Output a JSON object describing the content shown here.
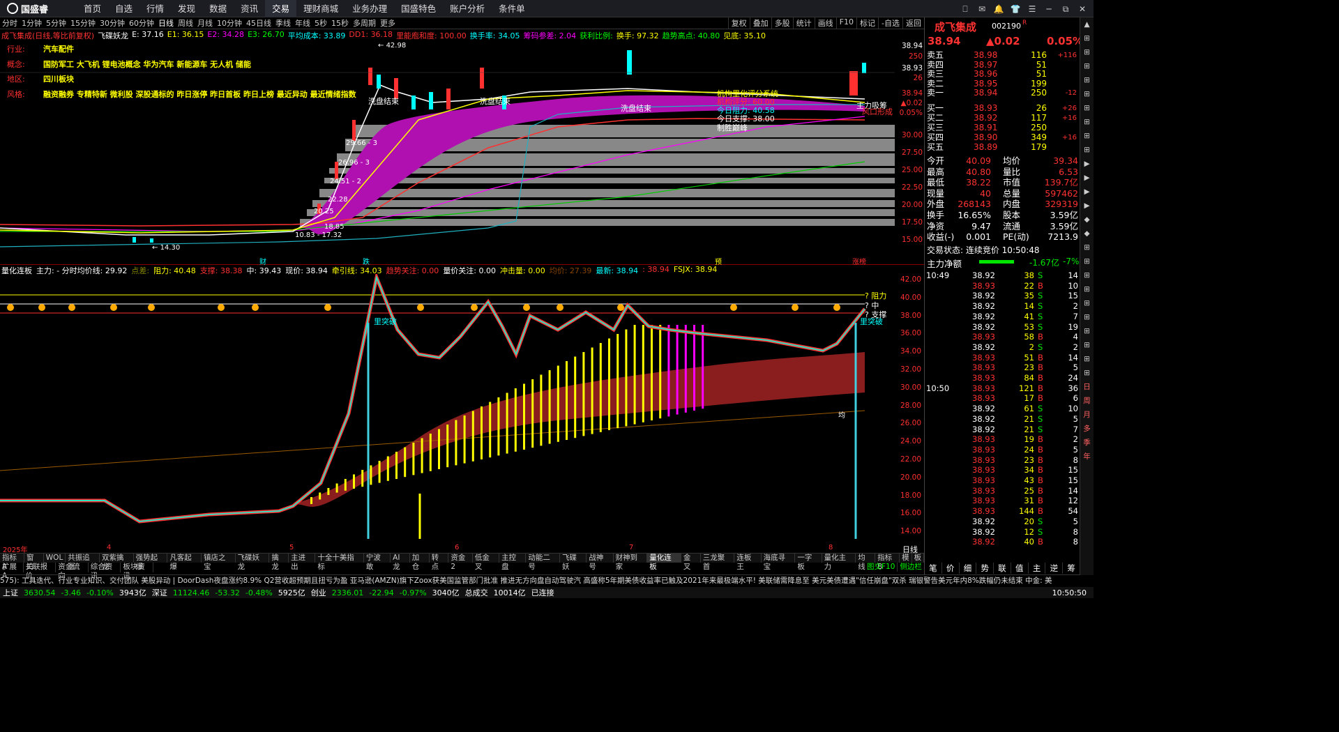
{
  "app": {
    "logo": "国盛睿"
  },
  "menu": [
    "首页",
    "自选",
    "行情",
    "发现",
    "数据",
    "资讯",
    "交易",
    "理财商城",
    "业务办理",
    "国盛特色",
    "账户分析",
    "条件单"
  ],
  "active_menu": "交易",
  "window_controls": [
    "⎕",
    "✉",
    "🔔",
    "👕",
    "☰",
    "─",
    "⧉",
    "✕"
  ],
  "periods": [
    "分时",
    "1分钟",
    "5分钟",
    "15分钟",
    "30分钟",
    "60分钟",
    "日线",
    "周线",
    "月线",
    "10分钟",
    "45日线",
    "季线",
    "年线",
    "5秒",
    "15秒",
    "多周期",
    "更多"
  ],
  "active_period": "日线",
  "tools": [
    "复权",
    "叠加",
    "多股",
    "统计",
    "画线",
    "F10",
    "标记",
    "-自选",
    "返回"
  ],
  "chart1": {
    "title": "成飞集成(日线,等比前复权)",
    "indicator": "飞碟妖龙",
    "values": [
      {
        "k": "E:",
        "v": "37.16",
        "c": "#fff"
      },
      {
        "k": "E1:",
        "v": "36.15",
        "c": "#ffff00"
      },
      {
        "k": "E2:",
        "v": "34.28",
        "c": "#ff00ff"
      },
      {
        "k": "E3:",
        "v": "26.70",
        "c": "#00ff00"
      },
      {
        "k": "平均成本:",
        "v": "33.89",
        "c": "#00ffff"
      },
      {
        "k": "DD1:",
        "v": "36.18",
        "c": "#ff3030"
      },
      {
        "k": "里能庖和度:",
        "v": "100.00",
        "c": "#ff3030"
      },
      {
        "k": "换手率:",
        "v": "34.05",
        "c": "#00ffff"
      },
      {
        "k": "筹码参差:",
        "v": "2.04",
        "c": "#ff00ff"
      },
      {
        "k": "获利比例:",
        "v": "",
        "c": "#00ff00"
      },
      {
        "k": "换手:",
        "v": "97.32",
        "c": "#ffff00"
      },
      {
        "k": "趋势高点:",
        "v": "40.80",
        "c": "#00ff00"
      },
      {
        "k": "见底:",
        "v": "35.10",
        "c": "#ffff00"
      }
    ]
  },
  "info": {
    "rows": [
      {
        "label": "行业:",
        "value": "汽车配件"
      },
      {
        "label": "概念:",
        "value": "国防军工 大飞机 锂电池概念 华为汽车 新能源车 无人机 储能"
      },
      {
        "label": "地区:",
        "value": "四川板块"
      },
      {
        "label": "风格:",
        "value": "融资融券 专精特新 微利股 深股通标的 昨日涨停 昨日首板 昨日上榜 最近异动 最近情绪指数"
      }
    ]
  },
  "chart1_annotations": {
    "high": "42.98",
    "low": "14.30",
    "range": "10.83 - 17.32",
    "wash1": "洗盘结束",
    "wash2": "洗盘结束",
    "wash3": "洗盘结束",
    "inst": "机构里化评分系统",
    "score": "机构评分: 60.00",
    "res": "今日阻力: 40.58",
    "sup": "今日支撑: 38.00",
    "win": "制胜巅峰",
    "main": "主力吸筹",
    "risk": "风口形成",
    "levels": [
      "29.66 - 3",
      "26.96 - 3",
      "24.51 - 2",
      "22.28",
      "20.25",
      "18.85"
    ]
  },
  "yaxis1": {
    "labels": [
      "38.94",
      "250",
      "38.93",
      "26",
      "38.94",
      "▲0.02",
      "0.05%",
      "30.00",
      "27.50",
      "25.00",
      "22.50",
      "20.00",
      "17.50",
      "15.00"
    ]
  },
  "chart1_datebar": {
    "items": [
      "财",
      "跌",
      "预",
      "涨榜"
    ]
  },
  "chart2": {
    "title": "量化连板",
    "values": [
      {
        "k": "主力: - 分时均价线:",
        "v": "29.92",
        "c": "#fff"
      },
      {
        "k": "点差:",
        "v": "",
        "c": "#888800"
      },
      {
        "k": "阻力:",
        "v": "40.48",
        "c": "#ffff00"
      },
      {
        "k": "支撑:",
        "v": "38.38",
        "c": "#ff3030"
      },
      {
        "k": "中:",
        "v": "39.43",
        "c": "#fff"
      },
      {
        "k": "现价:",
        "v": "38.94",
        "c": "#fff"
      },
      {
        "k": "牵引线:",
        "v": "34.03",
        "c": "#ffff00"
      },
      {
        "k": "趋势关注:",
        "v": "0.00",
        "c": "#ff3030"
      },
      {
        "k": "量价关注:",
        "v": "0.00",
        "c": "#fff"
      },
      {
        "k": "冲击量:",
        "v": "0.00",
        "c": "#ffff00"
      },
      {
        "k": "均价:",
        "v": "27.39",
        "c": "#884400"
      },
      {
        "k": "最新:",
        "v": "38.94",
        "c": "#00ffff"
      },
      {
        "k": ":",
        "v": "38.94",
        "c": "#ff3030"
      },
      {
        "k": "FSJX:",
        "v": "38.94",
        "c": "#ffff00"
      }
    ],
    "labels": {
      "res": "阻力",
      "mid": "中",
      "sup": "支撑",
      "break1": "里突破",
      "break2": "里突破",
      "avg": "均"
    }
  },
  "yaxis2": {
    "labels": [
      "42.00",
      "40.00",
      "38.00",
      "36.00",
      "34.00",
      "32.00",
      "30.00",
      "28.00",
      "26.00",
      "24.00",
      "22.00",
      "20.00",
      "18.00",
      "16.00",
      "14.00"
    ]
  },
  "bottom_dates": {
    "items": [
      "2025年",
      "4",
      "5",
      "6",
      "7",
      "8"
    ],
    "period": "日线"
  },
  "tabs1": [
    "指标A",
    "窗口",
    "WOL",
    "共振追涨",
    "双紫擒龙",
    "强势起爆",
    "凡客起爆",
    "镇店之宝",
    "飞碟妖龙",
    "擒龙",
    "主进出",
    "十全十美指标",
    "宁波敢",
    "AI龙",
    "加仓",
    "转点",
    "资金2",
    "低金叉",
    "主控盘",
    "动能二号",
    "飞碟妖",
    "战神号",
    "财神到家",
    "量化连板",
    "金叉",
    "三龙聚首",
    "连板王",
    "海底寻宝",
    "一字板",
    "量化主力",
    "均线",
    "指标B",
    "模",
    "板"
  ],
  "active_tab": "量化连板",
  "tabs2": [
    "扩展A",
    "关联报价",
    "资金流向",
    "综合资讯",
    "板块资讯"
  ],
  "tabs3": [
    "图交F10",
    "侧边栏"
  ],
  "ticker": "575): 工具迭代、行业专业知识、交付团队      美股异动 | DoorDash夜盘涨约8.9% Q2营收超预期且扭亏为盈      亚马逊(AMZN)旗下Zoox获美国监管部门批准  推进无方向盘自动驾驶汽      高盛称5年期美债收益率已触及2021年来最极端水平! 美联储需降息至      美元美债遭遇\"信任崩盘\"双杀  瑞银警告美元年内8%跌幅仍未结束      中金: 美",
  "status": {
    "items": [
      {
        "name": "上证",
        "v1": "3630.54",
        "v2": "-3.46",
        "v3": "-0.10%",
        "v4": "3943亿"
      },
      {
        "name": "深证",
        "v1": "11124.46",
        "v2": "-53.32",
        "v3": "-0.48%",
        "v4": "5925亿"
      },
      {
        "name": "创业",
        "v1": "2336.01",
        "v2": "-22.94",
        "v3": "-0.97%",
        "v4": "3040亿"
      }
    ],
    "total_label": "总成交",
    "total": "10014亿",
    "connected": "已连接",
    "time": "10:50:50"
  },
  "quote": {
    "name": "成飞集成",
    "code": "002190",
    "flag": "R",
    "price": "38.94",
    "change": "▲0.02",
    "pct": "0.05%",
    "asks": [
      {
        "l": "卖五",
        "p": "38.98",
        "v": "116",
        "d": "+116"
      },
      {
        "l": "卖四",
        "p": "38.97",
        "v": "51",
        "d": ""
      },
      {
        "l": "卖三",
        "p": "38.96",
        "v": "51",
        "d": ""
      },
      {
        "l": "卖二",
        "p": "38.95",
        "v": "199",
        "d": ""
      },
      {
        "l": "卖一",
        "p": "38.94",
        "v": "250",
        "d": "-12"
      }
    ],
    "bids": [
      {
        "l": "买一",
        "p": "38.93",
        "v": "26",
        "d": "+26"
      },
      {
        "l": "买二",
        "p": "38.92",
        "v": "117",
        "d": "+16"
      },
      {
        "l": "买三",
        "p": "38.91",
        "v": "250",
        "d": ""
      },
      {
        "l": "买四",
        "p": "38.90",
        "v": "349",
        "d": "+16"
      },
      {
        "l": "买五",
        "p": "38.89",
        "v": "179",
        "d": ""
      }
    ],
    "stats": [
      {
        "a": "今开",
        "b": "40.09",
        "c": "均价",
        "d": "39.34"
      },
      {
        "a": "最高",
        "b": "40.80",
        "c": "量比",
        "d": "6.53"
      },
      {
        "a": "最低",
        "b": "38.22",
        "c": "市值",
        "d": "139.7亿"
      },
      {
        "a": "现量",
        "b": "40",
        "c": "总量",
        "d": "597462"
      },
      {
        "a": "外盘",
        "b": "268143",
        "c": "内盘",
        "d": "329319"
      }
    ],
    "stats2": [
      {
        "a": "换手",
        "b": "16.65%",
        "c": "股本",
        "d": "3.59亿"
      },
      {
        "a": "净资",
        "b": "9.47",
        "c": "流通",
        "d": "3.59亿"
      },
      {
        "a": "收益(-)",
        "b": "0.001",
        "c": "PE(动)",
        "d": "7213.9"
      }
    ],
    "state": "交易状态: 连续竞价 10:50:48",
    "netflow_label": "主力净额",
    "netflow": "-1.67亿",
    "netflow_pct": "-7%"
  },
  "ticks": [
    {
      "t": "10:49",
      "p": "38.92",
      "v": "38",
      "s": "S",
      "n": "14"
    },
    {
      "t": "",
      "p": "38.93",
      "v": "22",
      "s": "B",
      "n": "10"
    },
    {
      "t": "",
      "p": "38.92",
      "v": "35",
      "s": "S",
      "n": "15"
    },
    {
      "t": "",
      "p": "38.92",
      "v": "14",
      "s": "S",
      "n": "2"
    },
    {
      "t": "",
      "p": "38.92",
      "v": "41",
      "s": "S",
      "n": "7"
    },
    {
      "t": "",
      "p": "38.92",
      "v": "53",
      "s": "S",
      "n": "19"
    },
    {
      "t": "",
      "p": "38.93",
      "v": "58",
      "s": "B",
      "n": "4"
    },
    {
      "t": "",
      "p": "38.92",
      "v": "2",
      "s": "S",
      "n": "2"
    },
    {
      "t": "",
      "p": "38.93",
      "v": "51",
      "s": "B",
      "n": "14"
    },
    {
      "t": "",
      "p": "38.93",
      "v": "23",
      "s": "B",
      "n": "5"
    },
    {
      "t": "",
      "p": "38.93",
      "v": "84",
      "s": "B",
      "n": "24"
    },
    {
      "t": "10:50",
      "p": "38.93",
      "v": "121",
      "s": "B",
      "n": "36"
    },
    {
      "t": "",
      "p": "38.93",
      "v": "17",
      "s": "B",
      "n": "6"
    },
    {
      "t": "",
      "p": "38.92",
      "v": "61",
      "s": "S",
      "n": "10"
    },
    {
      "t": "",
      "p": "38.92",
      "v": "21",
      "s": "S",
      "n": "5"
    },
    {
      "t": "",
      "p": "38.92",
      "v": "21",
      "s": "S",
      "n": "7"
    },
    {
      "t": "",
      "p": "38.93",
      "v": "19",
      "s": "B",
      "n": "2"
    },
    {
      "t": "",
      "p": "38.93",
      "v": "24",
      "s": "B",
      "n": "5"
    },
    {
      "t": "",
      "p": "38.93",
      "v": "23",
      "s": "B",
      "n": "8"
    },
    {
      "t": "",
      "p": "38.93",
      "v": "34",
      "s": "B",
      "n": "15"
    },
    {
      "t": "",
      "p": "38.93",
      "v": "43",
      "s": "B",
      "n": "15"
    },
    {
      "t": "",
      "p": "38.93",
      "v": "25",
      "s": "B",
      "n": "14"
    },
    {
      "t": "",
      "p": "38.93",
      "v": "31",
      "s": "B",
      "n": "12"
    },
    {
      "t": "",
      "p": "38.93",
      "v": "144",
      "s": "B",
      "n": "54"
    },
    {
      "t": "",
      "p": "38.92",
      "v": "20",
      "s": "S",
      "n": "5"
    },
    {
      "t": "",
      "p": "38.92",
      "v": "12",
      "s": "S",
      "n": "8"
    },
    {
      "t": "",
      "p": "38.92",
      "v": "40",
      "s": "B",
      "n": "8"
    }
  ],
  "right_tabs": [
    "笔",
    "价",
    "细",
    "势",
    "联",
    "值",
    "主",
    "逆",
    "筹"
  ],
  "sidebar": [
    "▲",
    "⊞",
    "⊞",
    "⊞",
    "⊞",
    "⊞",
    "⊞",
    "⊞",
    "⊞",
    "⊞",
    "▶",
    "▶",
    "▶",
    "▶",
    "◆",
    "◆",
    "⊞",
    "⊞",
    "⊞",
    "⊞",
    "⊞",
    "⊞",
    "⊞",
    "⊞",
    "⊞",
    "⊞",
    "日",
    "周",
    "月",
    "多",
    "季",
    "年"
  ]
}
